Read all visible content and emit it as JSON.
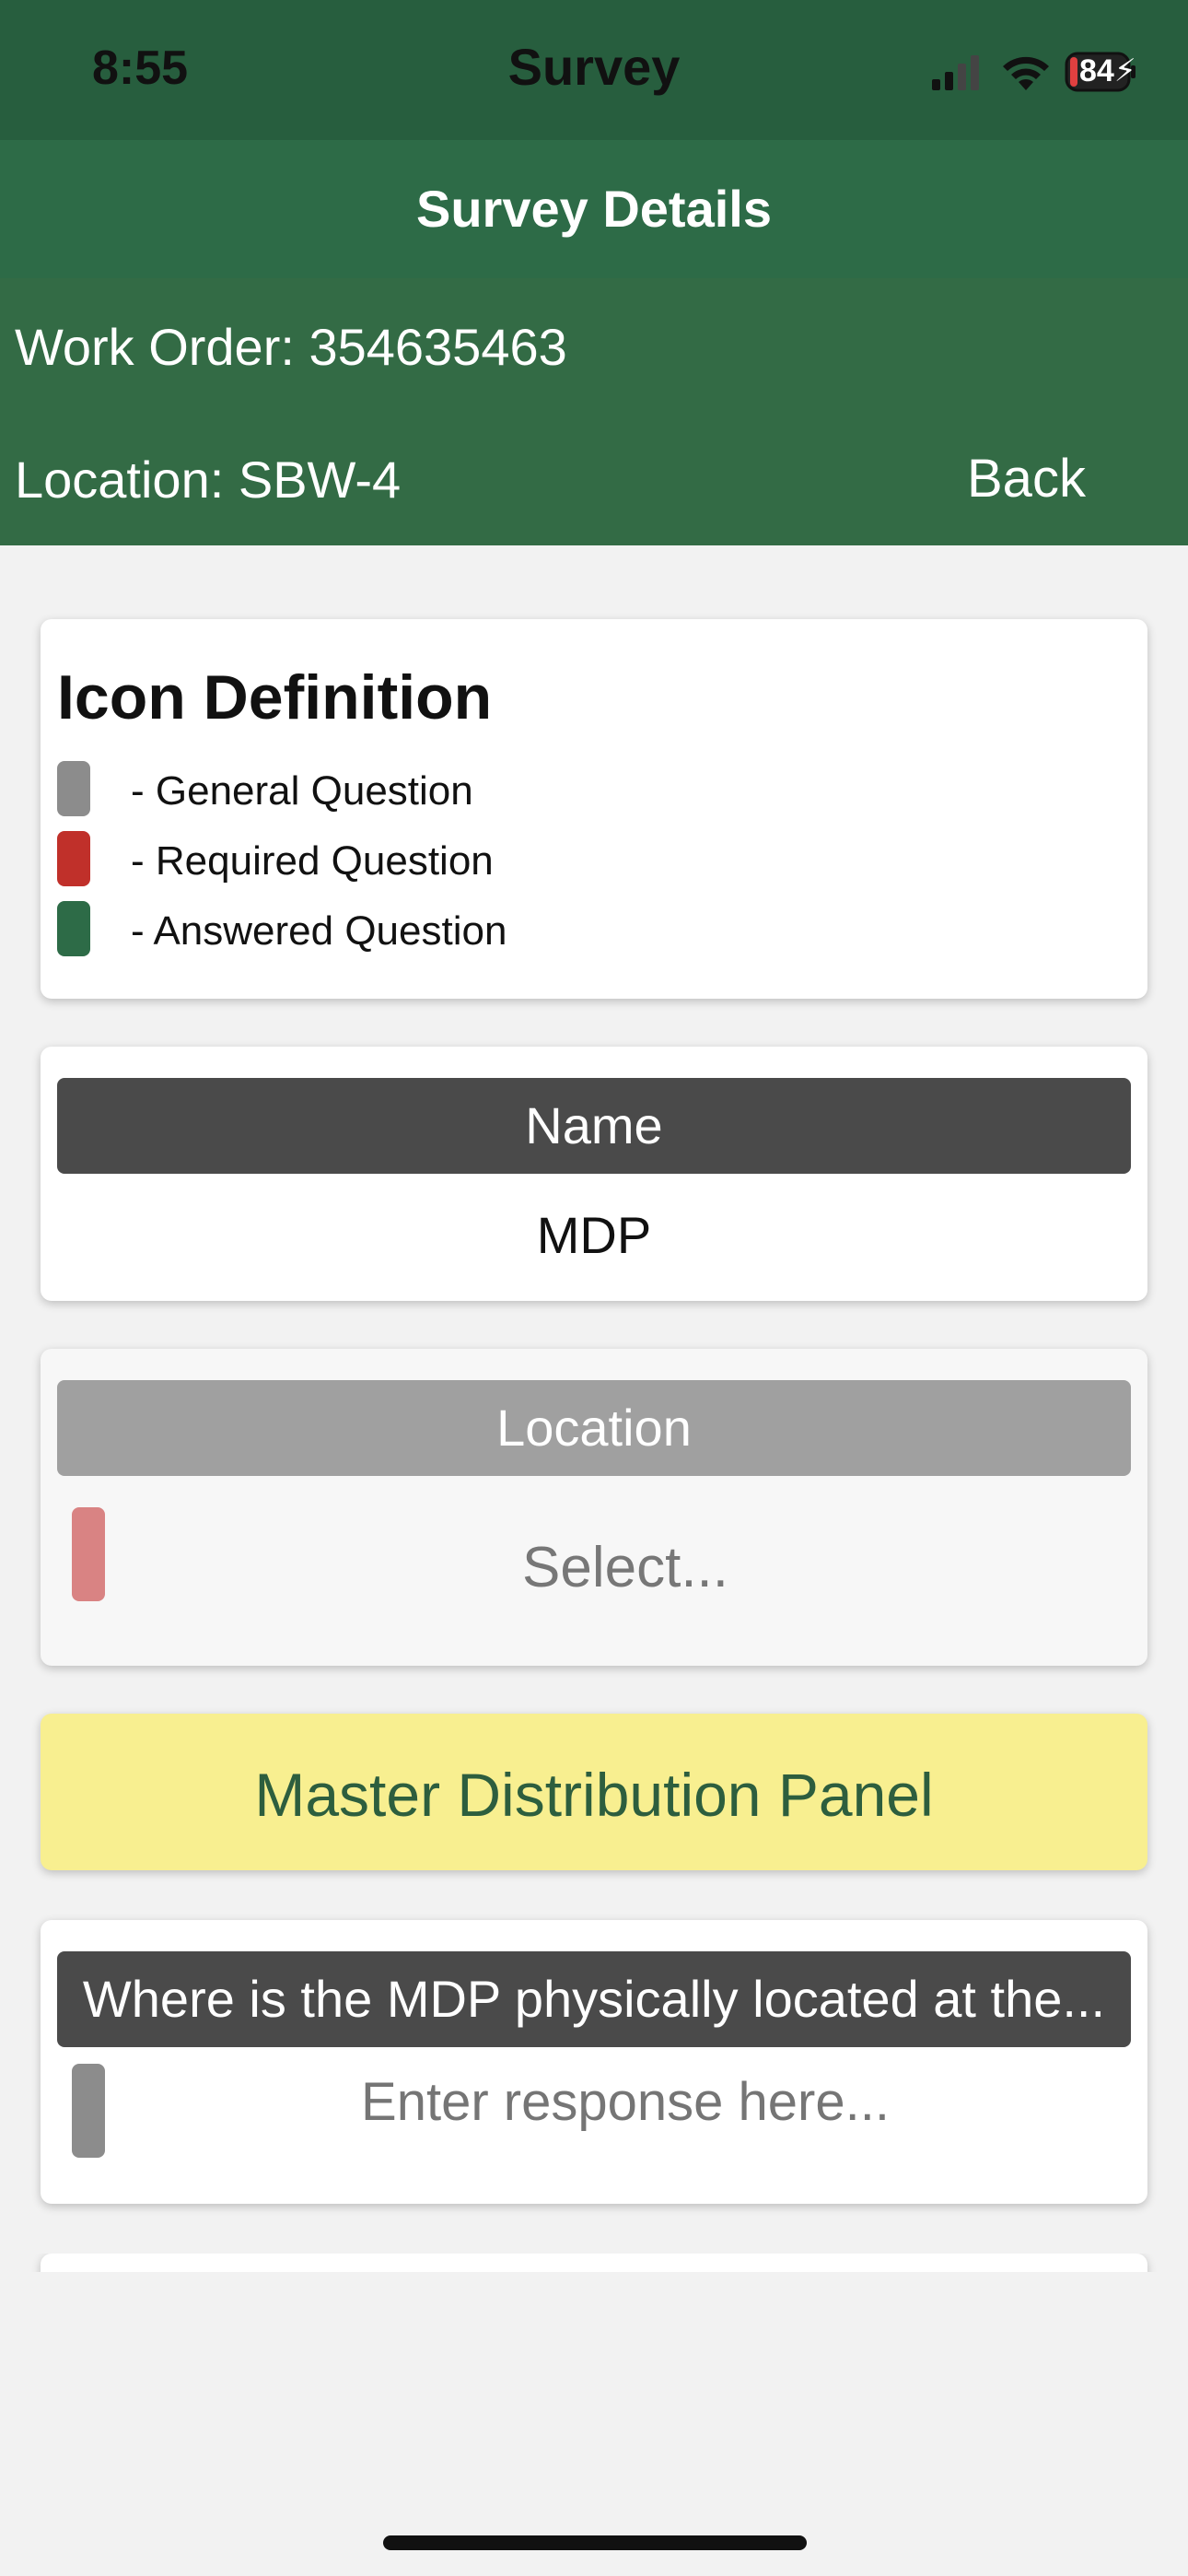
{
  "status_bar": {
    "time": "8:55",
    "app_title": "Survey",
    "battery": "84"
  },
  "header": {
    "title": "Survey Details"
  },
  "info": {
    "work_order": "Work Order: 354635463",
    "location": "Location: SBW-4",
    "back_label": "Back"
  },
  "icon_definition": {
    "title": "Icon Definition",
    "items": [
      {
        "label": "- General Question",
        "color": "#8c8c8c"
      },
      {
        "label": "- Required Question",
        "color": "#c0302a"
      },
      {
        "label": "- Answered Question",
        "color": "#2d6b47"
      }
    ]
  },
  "name_field": {
    "label": "Name",
    "value": "MDP"
  },
  "location_field": {
    "label": "Location",
    "placeholder": "Select...",
    "indicator_color": "#d98383"
  },
  "section": {
    "title": "Master Distribution Panel"
  },
  "question": {
    "label": "Where is the MDP physically located at the...",
    "placeholder": "Enter response here...",
    "indicator_color": "#8c8c8c"
  },
  "colors": {
    "status_bar": "#275e3e",
    "header": "#2d6b47",
    "info_bar": "#336b45",
    "section_bg": "#f8ef90"
  }
}
